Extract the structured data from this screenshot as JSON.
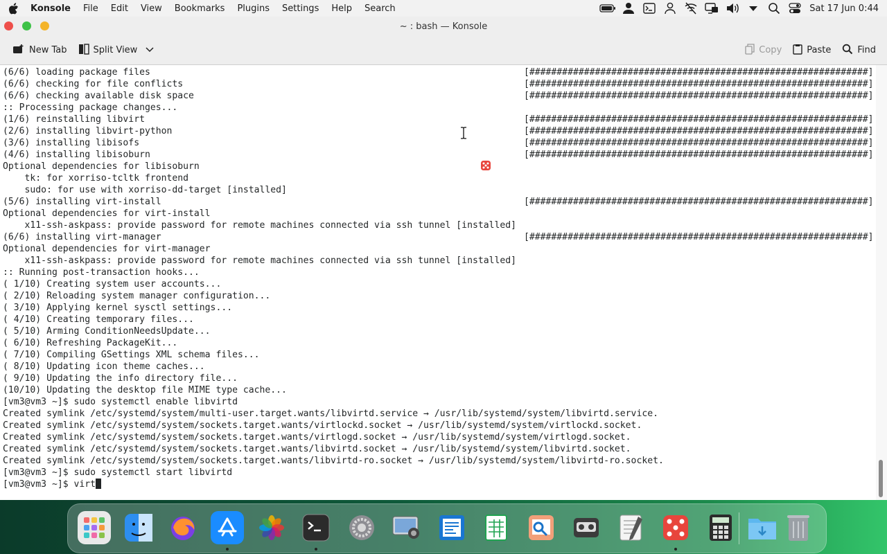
{
  "menubar": {
    "app_name": "Konsole",
    "items": [
      "File",
      "Edit",
      "View",
      "Bookmarks",
      "Plugins",
      "Settings",
      "Help",
      "Search"
    ],
    "clock": "Sat 17 Jun 0:44",
    "tray_icons": [
      "battery-icon",
      "user-icon",
      "terminal-icon",
      "accounts-icon",
      "wifi-off-icon",
      "display-icon",
      "volume-icon",
      "dropdown-icon",
      "search-icon",
      "control-center-icon"
    ]
  },
  "window": {
    "title": "~ : bash — Konsole"
  },
  "toolbar": {
    "new_tab": "New Tab",
    "split_view": "Split View",
    "copy": "Copy",
    "paste": "Paste",
    "find": "Find"
  },
  "terminal": {
    "lines": [
      {
        "text": "(6/6) loading package files",
        "progress": "[##############################################################] 100%"
      },
      {
        "text": "(6/6) checking for file conflicts",
        "progress": "[##############################################################] 100%"
      },
      {
        "text": "(6/6) checking available disk space",
        "progress": "[##############################################################] 100%"
      },
      {
        "text": ":: Processing package changes...",
        "progress": ""
      },
      {
        "text": "(1/6) reinstalling libvirt",
        "progress": "[##############################################################] 100%"
      },
      {
        "text": "(2/6) installing libvirt-python",
        "progress": "[##############################################################] 100%"
      },
      {
        "text": "(3/6) installing libisofs",
        "progress": "[##############################################################] 100%"
      },
      {
        "text": "(4/6) installing libisoburn",
        "progress": "[##############################################################] 100%"
      },
      {
        "text": "Optional dependencies for libisoburn",
        "progress": ""
      },
      {
        "text": "    tk: for xorriso-tcltk frontend",
        "progress": ""
      },
      {
        "text": "    sudo: for use with xorriso-dd-target [installed]",
        "progress": ""
      },
      {
        "text": "(5/6) installing virt-install",
        "progress": "[##############################################################] 100%"
      },
      {
        "text": "Optional dependencies for virt-install",
        "progress": ""
      },
      {
        "text": "    x11-ssh-askpass: provide password for remote machines connected via ssh tunnel [installed]",
        "progress": ""
      },
      {
        "text": "(6/6) installing virt-manager",
        "progress": "[##############################################################] 100%"
      },
      {
        "text": "Optional dependencies for virt-manager",
        "progress": ""
      },
      {
        "text": "    x11-ssh-askpass: provide password for remote machines connected via ssh tunnel [installed]",
        "progress": ""
      },
      {
        "text": ":: Running post-transaction hooks...",
        "progress": ""
      },
      {
        "text": "( 1/10) Creating system user accounts...",
        "progress": ""
      },
      {
        "text": "( 2/10) Reloading system manager configuration...",
        "progress": ""
      },
      {
        "text": "( 3/10) Applying kernel sysctl settings...",
        "progress": ""
      },
      {
        "text": "( 4/10) Creating temporary files...",
        "progress": ""
      },
      {
        "text": "( 5/10) Arming ConditionNeedsUpdate...",
        "progress": ""
      },
      {
        "text": "( 6/10) Refreshing PackageKit...",
        "progress": ""
      },
      {
        "text": "( 7/10) Compiling GSettings XML schema files...",
        "progress": ""
      },
      {
        "text": "( 8/10) Updating icon theme caches...",
        "progress": ""
      },
      {
        "text": "( 9/10) Updating the info directory file...",
        "progress": ""
      },
      {
        "text": "(10/10) Updating the desktop file MIME type cache...",
        "progress": ""
      },
      {
        "text": "[vm3@vm3 ~]$ sudo systemctl enable libvirtd",
        "progress": ""
      },
      {
        "text": "Created symlink /etc/systemd/system/multi-user.target.wants/libvirtd.service → /usr/lib/systemd/system/libvirtd.service.",
        "progress": ""
      },
      {
        "text": "Created symlink /etc/systemd/system/sockets.target.wants/virtlockd.socket → /usr/lib/systemd/system/virtlockd.socket.",
        "progress": ""
      },
      {
        "text": "Created symlink /etc/systemd/system/sockets.target.wants/virtlogd.socket → /usr/lib/systemd/system/virtlogd.socket.",
        "progress": ""
      },
      {
        "text": "Created symlink /etc/systemd/system/sockets.target.wants/libvirtd.socket → /usr/lib/systemd/system/libvirtd.socket.",
        "progress": ""
      },
      {
        "text": "Created symlink /etc/systemd/system/sockets.target.wants/libvirtd-ro.socket → /usr/lib/systemd/system/libvirtd-ro.socket.",
        "progress": ""
      },
      {
        "text": "[vm3@vm3 ~]$ sudo systemctl start libvirtd",
        "progress": ""
      }
    ],
    "prompt": "[vm3@vm3 ~]$ ",
    "input": "virt"
  },
  "dock": {
    "apps": [
      {
        "name": "launchpad-icon",
        "color": "#e9e9e9",
        "running": false
      },
      {
        "name": "finder-icon",
        "color": "#2d8ef0",
        "running": false
      },
      {
        "name": "firefox-icon",
        "color": "#ff7a2e",
        "running": false
      },
      {
        "name": "app-store-icon",
        "color": "#1a8cff",
        "running": true
      },
      {
        "name": "photos-icon",
        "color": "#ffffff",
        "running": false
      },
      {
        "name": "terminal-icon",
        "color": "#2b2b2b",
        "running": true
      },
      {
        "name": "system-settings-icon",
        "color": "#8e8e93",
        "running": false
      },
      {
        "name": "screenshot-icon",
        "color": "#cfd6dd",
        "running": false
      },
      {
        "name": "writer-icon",
        "color": "#1976d2",
        "running": false
      },
      {
        "name": "spreadsheet-icon",
        "color": "#21a351",
        "running": false
      },
      {
        "name": "preview-icon",
        "color": "#f2a07a",
        "running": false
      },
      {
        "name": "recorder-icon",
        "color": "#3b3b3b",
        "running": false
      },
      {
        "name": "text-editor-icon",
        "color": "#f4f4f4",
        "running": false
      },
      {
        "name": "dice-game-icon",
        "color": "#e8453c",
        "running": true
      },
      {
        "name": "calculator-icon",
        "color": "#dcdcdc",
        "running": false
      },
      {
        "name": "downloads-folder-icon",
        "color": "#5db7ef",
        "running": false
      },
      {
        "name": "trash-icon",
        "color": "#9aa0a6",
        "running": false
      }
    ]
  }
}
